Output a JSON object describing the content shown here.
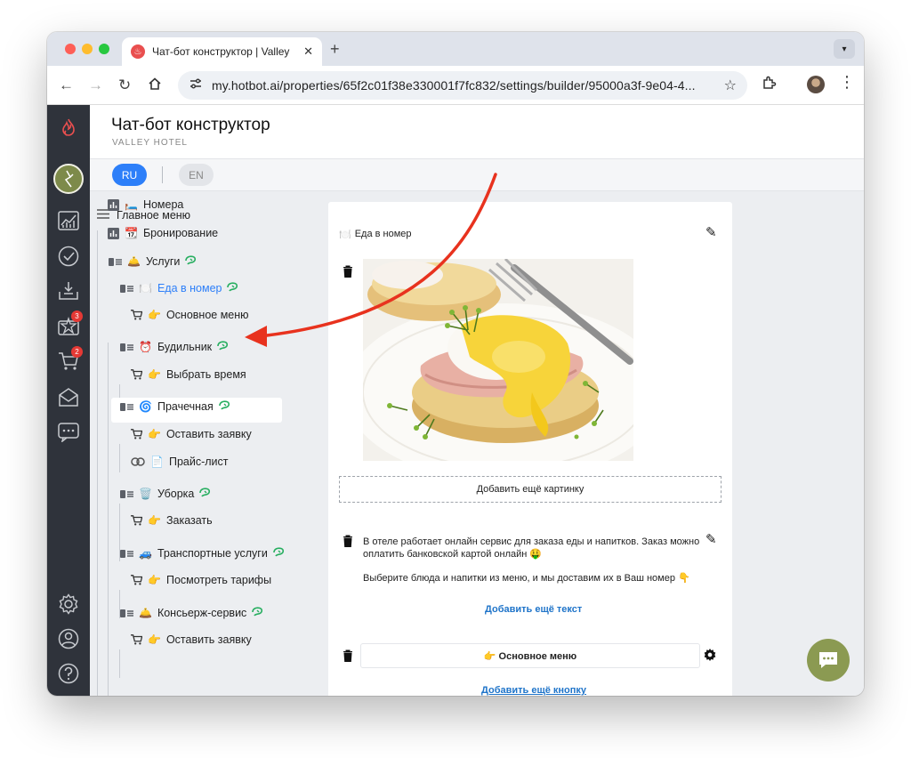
{
  "browser": {
    "tab_title": "Чат-бот конструктор | Valley",
    "tab_close": "✕",
    "new_tab": "+",
    "url": "my.hotbot.ai/properties/65f2c01f38e330001f7fc832/settings/builder/95000a3f-9e04-4..."
  },
  "sidebar": {
    "badges": {
      "reviews": "3",
      "cart": "2"
    }
  },
  "header": {
    "title": "Чат-бот конструктор",
    "subtitle": "VALLEY HOTEL"
  },
  "languages": {
    "active": "RU",
    "inactive": "EN"
  },
  "tree": {
    "root": "Главное меню",
    "items": [
      {
        "emoji": "🛏️",
        "label": "Номера"
      },
      {
        "emoji": "📆",
        "label": "Бронирование"
      },
      {
        "emoji": "🛎️",
        "label": "Услуги"
      },
      {
        "emoji": "🍽️",
        "label": "Еда в номер"
      },
      {
        "emoji": "👉",
        "label": "Основное меню"
      },
      {
        "emoji": "⏰",
        "label": "Будильник"
      },
      {
        "emoji": "👉",
        "label": "Выбрать время"
      },
      {
        "emoji": "🌀",
        "label": "Прачечная"
      },
      {
        "emoji": "👉",
        "label": "Оставить заявку"
      },
      {
        "emoji": "📄",
        "label": "Прайс-лист"
      },
      {
        "emoji": "🗑️",
        "label": "Уборка"
      },
      {
        "emoji": "👉",
        "label": "Заказать"
      },
      {
        "emoji": "🚙",
        "label": "Транспортные услуги"
      },
      {
        "emoji": "👉",
        "label": "Посмотреть тарифы"
      },
      {
        "emoji": "🛎️",
        "label": "Консьерж-сервис"
      },
      {
        "emoji": "👉",
        "label": "Оставить заявку"
      }
    ]
  },
  "editor": {
    "title_emoji": "🍽️",
    "title": "Еда в номер",
    "add_image": "Добавить ещё картинку",
    "text_p1": "В отеле работает онлайн сервис для заказа еды и напитков. Заказ можно оплатить банковской картой онлайн 🤑",
    "text_p2": "Выберите блюда и напитки из меню, и мы доставим их в Ваш номер 👇",
    "add_text": "Добавить ещё текст",
    "button_label": "👉 Основное меню",
    "add_button": "Добавить ещё кнопку"
  },
  "colors": {
    "accent": "#2d7ff9",
    "link": "#1f74c9",
    "sidebar_bg": "#2f333b",
    "brand_olive": "#7d8a4a",
    "arrow_red": "#e8321e",
    "leaf_green": "#27ae60"
  }
}
